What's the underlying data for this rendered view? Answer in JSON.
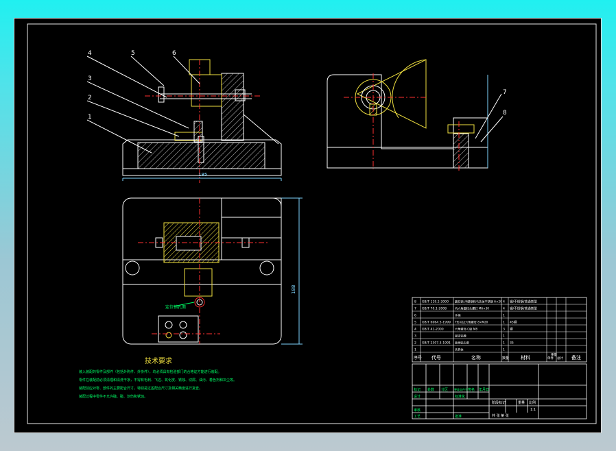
{
  "callouts_front": [
    "4",
    "5",
    "6",
    "3",
    "2",
    "1"
  ],
  "callouts_side": [
    "7",
    "8"
  ],
  "dimensions": {
    "front_width": "185",
    "top_height": "188"
  },
  "top_view_label": "定位销孔面",
  "tech_requirements": {
    "title": "技术要求",
    "lines": [
      "装入装配的零件及部件（包括外购件、外协件），均必须具有检验部门的合格证方能进行装配。",
      "零件在装配前必须清理和清洗干净，不得有毛刺、飞边、氧化皮、锈蚀、切屑、油污、着色剂和灰尘等。",
      "装配前应对零、部件的主要配合尺寸，特别是过盈配合尺寸及相关精度进行复查。",
      "装配过程中零件不允许磕、碰、划伤和锈蚀。"
    ]
  },
  "bom": {
    "rows": [
      {
        "no": "8",
        "code": "GB/T 119.2-2000",
        "name": "圆柱销-淬硬钢和马氏体不锈钢 6×20",
        "qty": "4",
        "material": "钢/不锈钢/普通类型"
      },
      {
        "no": "7",
        "code": "GB/T 70.1-2008",
        "name": "内六角圆柱头螺钉 M6×30",
        "qty": "4",
        "material": "钢/不锈钢/普通类型"
      },
      {
        "no": "6",
        "code": "",
        "name": "手柄",
        "qty": "1",
        "material": ""
      },
      {
        "no": "5",
        "code": "GB/T 6064.5-1999",
        "name": "T形对边六角螺母 8×M20",
        "qty": "1",
        "material": "45钢"
      },
      {
        "no": "4",
        "code": "GB/T 41-2000",
        "name": "六角螺母-C级 M8",
        "qty": "3",
        "material": "钢"
      },
      {
        "no": "3",
        "code": "",
        "name": "固定钻模",
        "qty": "1",
        "material": ""
      },
      {
        "no": "2",
        "code": "GB/T 2307.3-1991",
        "name": "直柄钻头套",
        "qty": "1",
        "material": "35"
      },
      {
        "no": "1",
        "code": "",
        "name": "夹具体",
        "qty": "1",
        "material": ""
      }
    ],
    "header": {
      "no": "序号",
      "code": "代号",
      "name": "名称",
      "qty": "数量",
      "material": "材料",
      "unit_single": "单件",
      "unit_total": "总计",
      "weight": "重量",
      "remark": "备注"
    }
  },
  "title_block": {
    "row_labels": [
      "标记",
      "处数",
      "分区",
      "更改文件号",
      "签名",
      "年月日"
    ],
    "design": "设计",
    "review": "审核",
    "process": "工艺",
    "standard": "标准化",
    "approve": "批准",
    "stage": "阶段标记",
    "weight": "重量",
    "scale": "比例",
    "scale_value": "1:1",
    "sheets": "共  张  第  张"
  }
}
